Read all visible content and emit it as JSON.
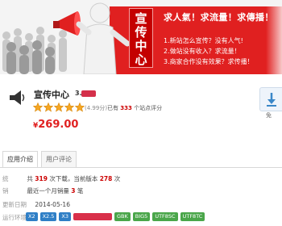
{
  "banner": {
    "vertical_title": "宣传中心",
    "headline": "求人氣！求流量！求傳播！",
    "lines": [
      "1.新站怎么宣传？没有人气!",
      "2.做站没有收入？求流量！",
      "3.商家合作没有效果？求传播！"
    ],
    "colors": {
      "accent": "#e02020",
      "text_on_accent": "#ffffff"
    }
  },
  "product": {
    "icon": "megaphone-icon",
    "title": "宣传中心",
    "version": "3.",
    "stars": 5,
    "rating": "(4.99分)",
    "rated_prefix": "已有",
    "rated_count": "333",
    "rated_suffix": "个站点评分",
    "price_symbol": "¥",
    "price": "269.00",
    "download_icon": "download-icon",
    "download_label": "免"
  },
  "tabs": [
    {
      "label": "应用介绍",
      "active": true
    },
    {
      "label": "用户评论",
      "active": false
    }
  ],
  "details": {
    "downloads": {
      "label": "统",
      "prefix": "共",
      "total": "319",
      "middle": "次下载，当前版本",
      "current": "278",
      "suffix": "次"
    },
    "sales": {
      "label": "销",
      "prefix": "最近一个月销量",
      "count": "3",
      "suffix": "笔"
    },
    "updated": {
      "label": "更新日期",
      "value": "2014-05-16"
    },
    "env": {
      "label": "运行环境",
      "badges": [
        "X2",
        "X2.5",
        "X3",
        "GBK",
        "BIG5",
        "UTF8SC",
        "UTF8TC"
      ]
    }
  }
}
